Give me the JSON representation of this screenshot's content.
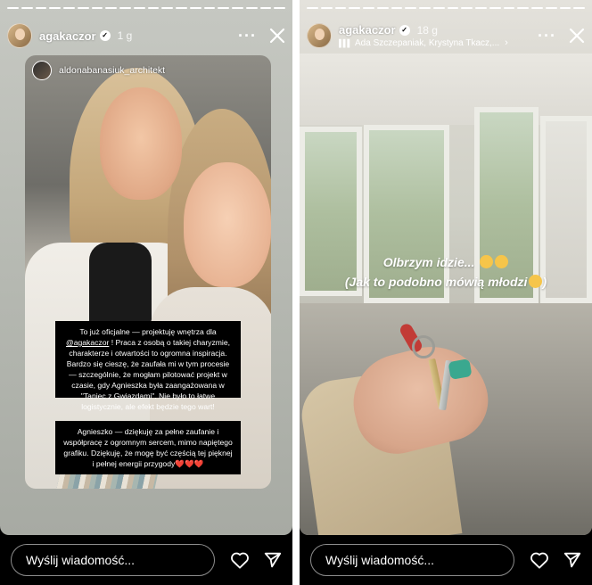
{
  "left_story": {
    "progress_segments": 20,
    "progress_done": 20,
    "username": "agakaczor",
    "time": "1 g",
    "shared_post": {
      "author": "aldonabanasiuk_architekt",
      "text1_before": "To już oficjalne — projektuję wnętrza dla ",
      "text1_mention": "@agakaczor",
      "text1_after": " ! Praca z osobą o takiej charyzmie, charakterze i otwartości to ogromna inspiracja. Bardzo się cieszę, że zaufała mi w tym procesie — szczególnie, że mogłam pilotować projekt w czasie, gdy Agnieszka była zaangażowana w \"Taniec z Gwiazdami\". Nie było to łatwe logistycznie, ale efekt będzie tego wart!",
      "text2": "Agnieszko — dziękuję za pełne zaufanie i współpracę z ogromnym sercem, mimo napiętego grafiku. Dziękuję, że mogę być częścią tej pięknej i pełnej energii przygody❤️❤️❤️"
    },
    "message_placeholder": "Wyślij wiadomość..."
  },
  "right_story": {
    "progress_segments": 20,
    "progress_done": 20,
    "username": "agakaczor",
    "time": "18 g",
    "music_text": "Ada Szczepaniak, Krystyna Tkacz,...",
    "caption_line1": "Olbrzym idzie...",
    "caption_line2": "(Jak to podobno mówią młodzi",
    "caption_line2_end": ")",
    "message_placeholder": "Wyślij wiadomość..."
  },
  "icons": {
    "more": "more-options-icon",
    "close": "close-icon",
    "like": "heart-icon",
    "send": "send-icon",
    "verified": "verified-badge-icon",
    "music": "music-bars-icon"
  },
  "colors": {
    "background": "#000000",
    "text": "#ffffff",
    "emoji": "#f6c54a",
    "heart": "#e0245e"
  }
}
